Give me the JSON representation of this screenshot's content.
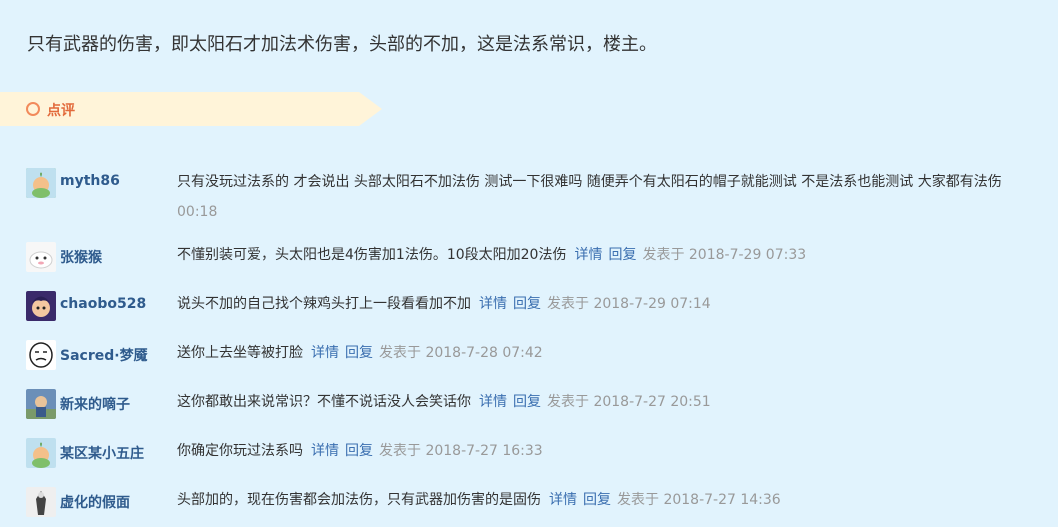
{
  "post": {
    "text": "只有武器的伤害，即太阳石才加法术伤害，头部的不加，这是法系常识，楼主。"
  },
  "review": {
    "label": "点评"
  },
  "comments": [
    {
      "user": "myth86",
      "text": "只有没玩过法系的 才会说出 头部太阳石不加法伤 测试一下很难吗 随便弄个有太阳石的帽子就能测试 不是法系也能测试 大家都有法伤",
      "second_line": "00:18",
      "detail": "",
      "reply": "",
      "posted": "",
      "avatar_color": "#8ec67f"
    },
    {
      "user": "张猴猴",
      "text": "不懂别装可爱，头太阳也是4伤害加1法伤。10段太阳加20法伤",
      "detail": "详情",
      "reply": "回复",
      "posted": "发表于 2018-7-29 07:33",
      "avatar_color": "#f2f2f2"
    },
    {
      "user": "chaobo528",
      "text": "说头不加的自己找个辣鸡头打上一段看看加不加",
      "detail": "详情",
      "reply": "回复",
      "posted": "发表于 2018-7-29 07:14",
      "avatar_color": "#5a3fa0"
    },
    {
      "user": "Sacred·梦魇",
      "text": "送你上去坐等被打脸",
      "detail": "详情",
      "reply": "回复",
      "posted": "发表于 2018-7-28 07:42",
      "avatar_color": "#ffffff"
    },
    {
      "user": "新来的嘀子",
      "text": "这你都敢出来说常识？不懂不说话没人会笑话你",
      "detail": "详情",
      "reply": "回复",
      "posted": "发表于 2018-7-27 20:51",
      "avatar_color": "#4a78a8"
    },
    {
      "user": "某区某小五庄",
      "text": "你确定你玩过法系吗",
      "detail": "详情",
      "reply": "回复",
      "posted": "发表于 2018-7-27 16:33",
      "avatar_color": "#8ec67f"
    },
    {
      "user": "虚化的假面",
      "text": "头部加的，现在伤害都会加法伤，只有武器加伤害的是固伤",
      "detail": "详情",
      "reply": "回复",
      "posted": "发表于 2018-7-27 14:36",
      "avatar_color": "#cfcfcf"
    }
  ]
}
